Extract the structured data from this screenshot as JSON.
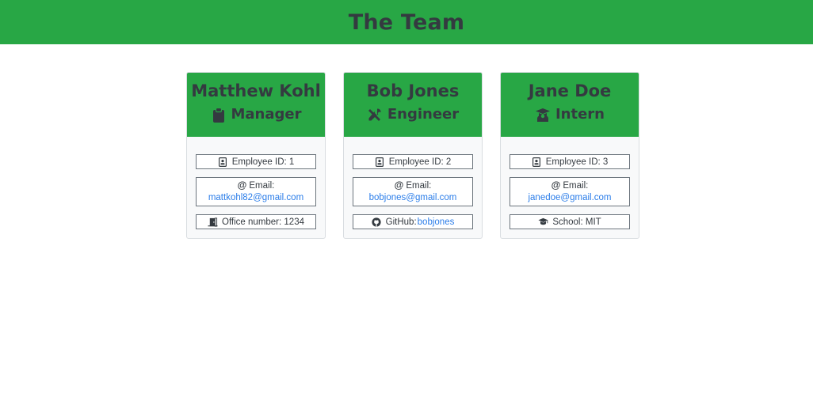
{
  "page": {
    "title": "The Team",
    "accent_color": "#28a745"
  },
  "team": [
    {
      "name": "Matthew Kohl",
      "role": "Manager",
      "role_icon": "clipboard-icon",
      "id_label": "Employee ID: 1",
      "email_label": "Email:",
      "email": "mattkohl82@gmail.com",
      "extra_prefix": "Office number: 1234",
      "extra_link": "",
      "extra_icon": "door-icon"
    },
    {
      "name": "Bob Jones",
      "role": "Engineer",
      "role_icon": "tools-icon",
      "id_label": "Employee ID: 2",
      "email_label": "Email:",
      "email": "bobjones@gmail.com",
      "extra_prefix": "GitHub: ",
      "extra_link": "bobjones",
      "extra_icon": "github-icon"
    },
    {
      "name": "Jane Doe",
      "role": "Intern",
      "role_icon": "graduate-icon",
      "id_label": "Employee ID: 3",
      "email_label": "Email:",
      "email": "janedoe@gmail.com",
      "extra_prefix": "School: MIT",
      "extra_link": "",
      "extra_icon": "graduation-cap-icon"
    }
  ]
}
